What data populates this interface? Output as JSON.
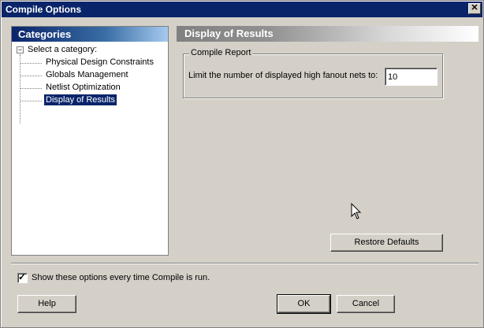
{
  "window": {
    "title": "Compile Options",
    "close_glyph": "✕"
  },
  "left_panel": {
    "header": "Categories",
    "root_label": "Select a category:",
    "expander_glyph": "−",
    "items": [
      {
        "label": "Physical Design Constraints",
        "selected": false
      },
      {
        "label": "Globals Management",
        "selected": false
      },
      {
        "label": "Netlist Optimization",
        "selected": false
      },
      {
        "label": "Display of Results",
        "selected": true
      }
    ]
  },
  "right_panel": {
    "header": "Display of Results",
    "group": {
      "legend": "Compile Report",
      "description": "Limit the number of displayed high fanout nets to:",
      "value": "10"
    },
    "restore_label": "Restore Defaults"
  },
  "footer": {
    "checkbox_label": "Show these options every time Compile is run.",
    "checkbox_checked": true,
    "check_glyph": "✓",
    "help_label": "Help",
    "ok_label": "OK",
    "cancel_label": "Cancel"
  },
  "icons": {
    "close": "close-icon",
    "expander": "collapse-icon",
    "cursor": "mouse-cursor-icon"
  },
  "colors": {
    "selection": "#0a246a",
    "face": "#d4d0c8",
    "titlebar": "#0a246a"
  }
}
